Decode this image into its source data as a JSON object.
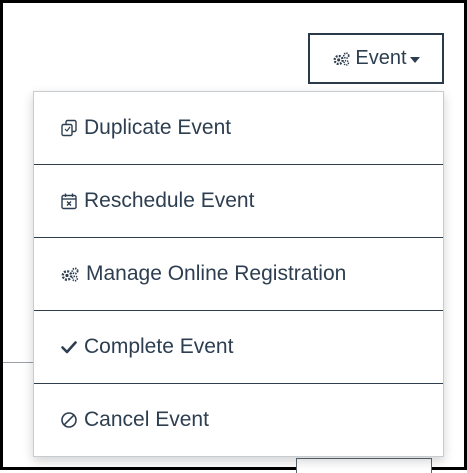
{
  "event_button": {
    "label": "Event",
    "icon": "gears-icon"
  },
  "menu": {
    "items": [
      {
        "label": "Duplicate Event",
        "icon": "duplicate-icon"
      },
      {
        "label": "Reschedule Event",
        "icon": "calendar-x-icon"
      },
      {
        "label": "Manage Online Registration",
        "icon": "gears-icon"
      },
      {
        "label": "Complete Event",
        "icon": "checkmark-icon"
      },
      {
        "label": "Cancel Event",
        "icon": "ban-icon"
      }
    ]
  },
  "colors": {
    "text": "#2d3e50",
    "border": "#2a3a4a",
    "frame": "#000000"
  }
}
